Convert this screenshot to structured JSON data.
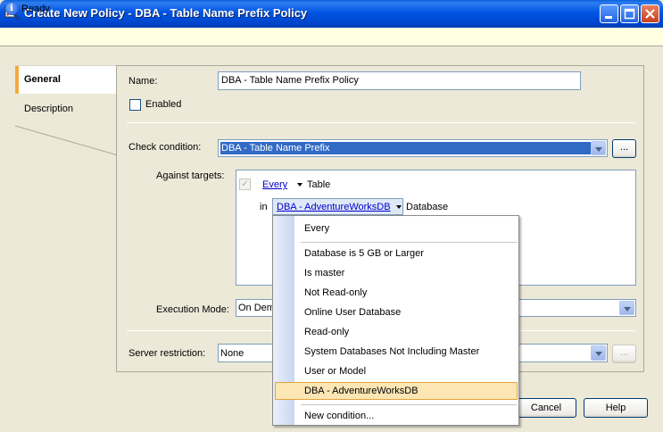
{
  "window": {
    "title": "Create New Policy - DBA - Table Name Prefix Policy",
    "status": "Ready"
  },
  "tabs": [
    "General",
    "Description"
  ],
  "form": {
    "name_label": "Name:",
    "name_value": "DBA - Table Name Prefix Policy",
    "enabled_label": "Enabled",
    "check_condition_label": "Check condition:",
    "check_condition_value": "DBA - Table Name Prefix",
    "browse_label": "...",
    "against_targets_label": "Against targets:",
    "targets": {
      "every_label": "Every",
      "object_label": "Table",
      "in_label": "in",
      "db_condition": "DBA - AdventureWorksDB",
      "db_label": "Database"
    },
    "execution_mode_label": "Execution Mode:",
    "execution_mode_value": "On Demand",
    "server_restriction_label": "Server restriction:",
    "server_restriction_value": "None",
    "server_browse_label": "..."
  },
  "dropdown": {
    "items": [
      "Every",
      "Database is 5 GB or Larger",
      "Is master",
      "Not Read-only",
      "Online User Database",
      "Read-only",
      "System Databases Not Including Master",
      "User or Model",
      "DBA - AdventureWorksDB",
      "New condition..."
    ],
    "selected_index": 8
  },
  "buttons": {
    "cancel": "Cancel",
    "help": "Help"
  }
}
